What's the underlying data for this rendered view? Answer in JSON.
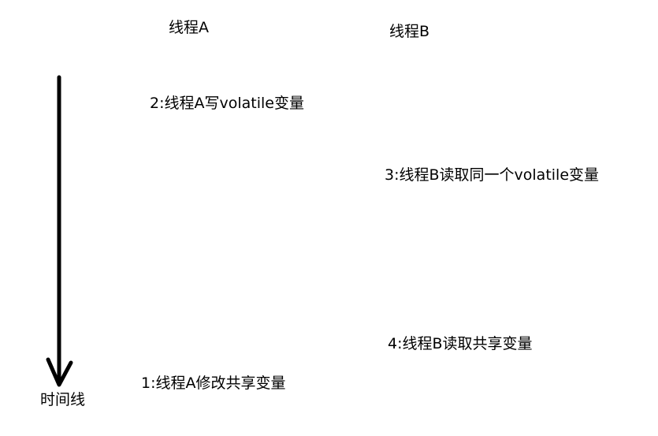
{
  "headers": {
    "thread_a": "线程A",
    "thread_b": "线程B"
  },
  "events": {
    "step1": "1:线程A修改共享变量",
    "step2": "2:线程A写volatile变量",
    "step3": "3:线程B读取同一个volatile变量",
    "step4": "4:线程B读取共享变量"
  },
  "timeline": {
    "label": "时间线",
    "arrow_direction": "down",
    "color": "#000000"
  }
}
